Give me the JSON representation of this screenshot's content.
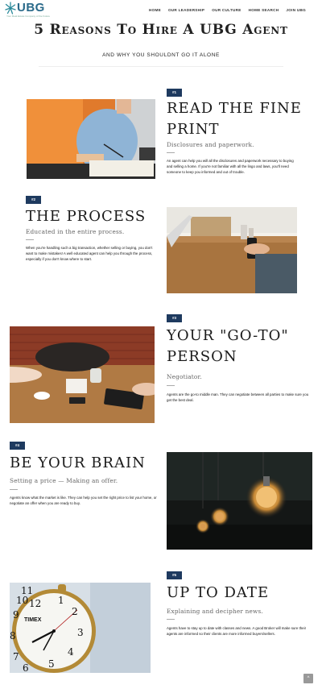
{
  "brand": {
    "logo_text": "UBG",
    "tagline": "Your Real Estate Company of the Future"
  },
  "nav": [
    {
      "label": "Home"
    },
    {
      "label": "Our Leadership"
    },
    {
      "label": "Our Culture"
    },
    {
      "label": "Home Search"
    },
    {
      "label": "Join UBG"
    }
  ],
  "hero": {
    "title": "5 Reasons To Hire A UBG Agent",
    "subtitle": "And why you shouldnt go it alone"
  },
  "sections": [
    {
      "badge": "#1",
      "title": "Read the fine print",
      "subtitle": "Disclosures and paperwork.",
      "body": "An agent can help you will all the disclosures and paperwork necessary to buying and selling a home. If you're not familiar with all the lingo and laws, you'll need someone to keep you informed and out of trouble."
    },
    {
      "badge": "#2",
      "title": "The Process",
      "subtitle": "Educated in the entire process.",
      "body": "When you're handling such a big transaction, whether selling or buying, you don't want to make mistakes! A well educated agent can help you through the process, especially if you don't know where to start."
    },
    {
      "badge": "#3",
      "title": "Your \"Go-To\" Person",
      "subtitle": "Negotiator.",
      "body": "Agents are the go-to middle man. They can negotiate between all parties to make sure you get the best deal."
    },
    {
      "badge": "#4",
      "title": "Be your brain",
      "subtitle": "Setting a price — Making an offer.",
      "body": "Agents know what the market is like. They can help you set the right price to list your home, or negotiate an offer when you are ready to buy."
    },
    {
      "badge": "#5",
      "title": "Up to date",
      "subtitle": "Explaining and decipher news.",
      "body": "Agents have to stay up to date with classes and news. A good Broker will make sure their agents are informed so their clients are more informed buyers/sellers."
    }
  ],
  "photos": {
    "clock_brand": "TIMEX",
    "clock_numbers": [
      "12",
      "1",
      "2",
      "3",
      "4",
      "5",
      "6",
      "7",
      "8",
      "9",
      "10",
      "11"
    ]
  },
  "back_to_top": "^"
}
